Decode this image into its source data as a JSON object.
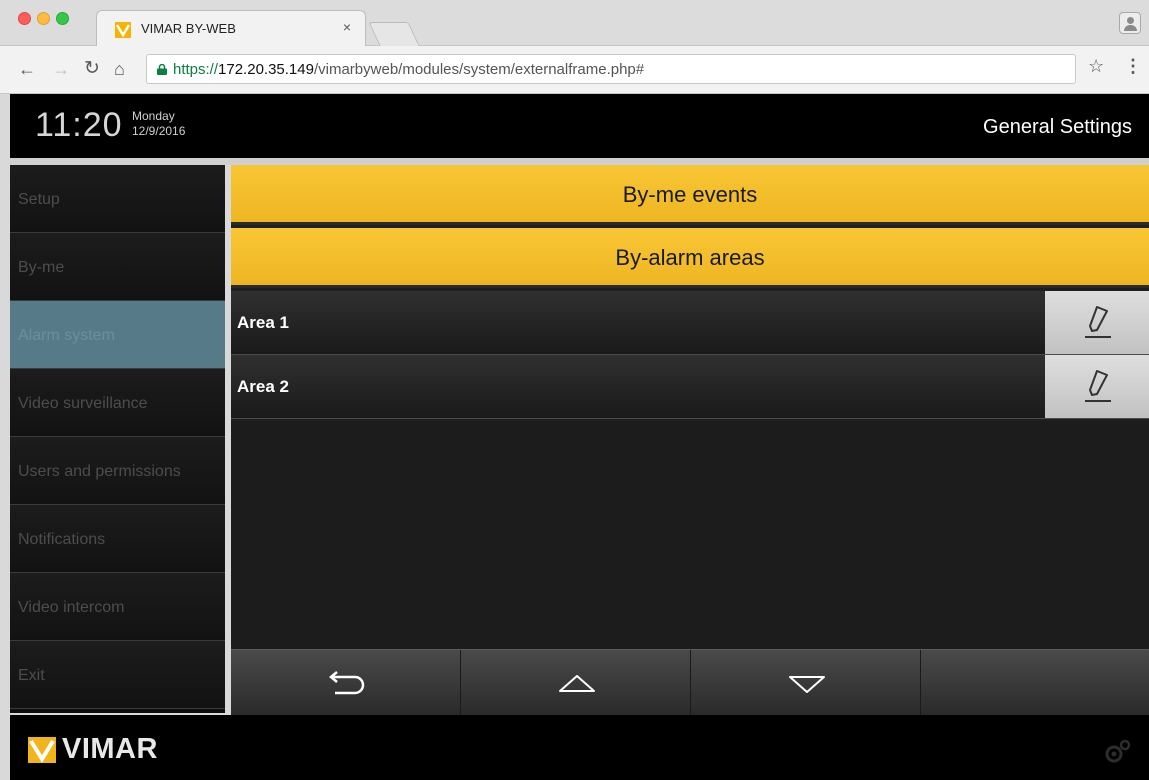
{
  "browser": {
    "tab_title": "VIMAR BY-WEB",
    "tab_close": "×",
    "url_scheme": "https://",
    "url_host": "172.20.35.149",
    "url_path": "/vimarbyweb/modules/system/externalframe.php#",
    "icons": [
      "back-icon",
      "forward-icon",
      "reload-icon",
      "home-icon",
      "lock-icon",
      "star-icon",
      "menu-icon",
      "profile-icon"
    ]
  },
  "header": {
    "time": "11:20",
    "day": "Monday",
    "date": "12/9/2016",
    "title": "General Settings"
  },
  "sidebar": {
    "items": [
      {
        "label": "Setup"
      },
      {
        "label": "By-me"
      },
      {
        "label": "Alarm system",
        "active": true
      },
      {
        "label": "Video surveillance"
      },
      {
        "label": "Users and permissions"
      },
      {
        "label": "Notifications"
      },
      {
        "label": "Video intercom"
      },
      {
        "label": "Exit"
      }
    ]
  },
  "main": {
    "buttons": [
      "By-me events",
      "By-alarm areas"
    ],
    "areas": [
      {
        "label": "Area 1",
        "action_icon": "pencil-icon"
      },
      {
        "label": "Area 2",
        "action_icon": "pencil-icon"
      }
    ],
    "toolbar_icons": [
      "back-arrow-icon",
      "up-arrow-icon",
      "down-arrow-icon"
    ]
  },
  "footer": {
    "logo_text": "VIMAR",
    "icon": "gear-icon"
  },
  "colors": {
    "accent_yellow": "#f5c02c",
    "active_sidebar": "#577a88",
    "background": "#000000"
  }
}
